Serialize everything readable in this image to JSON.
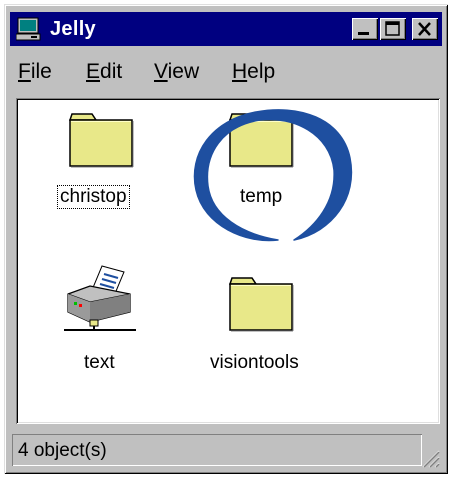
{
  "window": {
    "title": "Jelly",
    "app_icon": "computer-icon",
    "controls": {
      "minimize": "minimize-icon",
      "maximize": "maximize-icon",
      "close": "close-icon"
    }
  },
  "menubar": {
    "items": [
      {
        "mnemonic": "F",
        "rest": "ile"
      },
      {
        "mnemonic": "E",
        "rest": "dit"
      },
      {
        "mnemonic": "V",
        "rest": "iew"
      },
      {
        "mnemonic": "H",
        "rest": "elp"
      }
    ]
  },
  "content": {
    "items": [
      {
        "label": "christop",
        "icon": "folder-icon",
        "focused": true
      },
      {
        "label": "temp",
        "icon": "folder-icon",
        "circled": true
      },
      {
        "label": "text",
        "icon": "printer-icon"
      },
      {
        "label": "visiontools",
        "icon": "folder-icon"
      }
    ]
  },
  "statusbar": {
    "text": "4 object(s)"
  },
  "colors": {
    "titlebar": "#000080",
    "face": "#c0c0c0",
    "folder": "#e8e889",
    "annotation": "#1e4fa0"
  }
}
